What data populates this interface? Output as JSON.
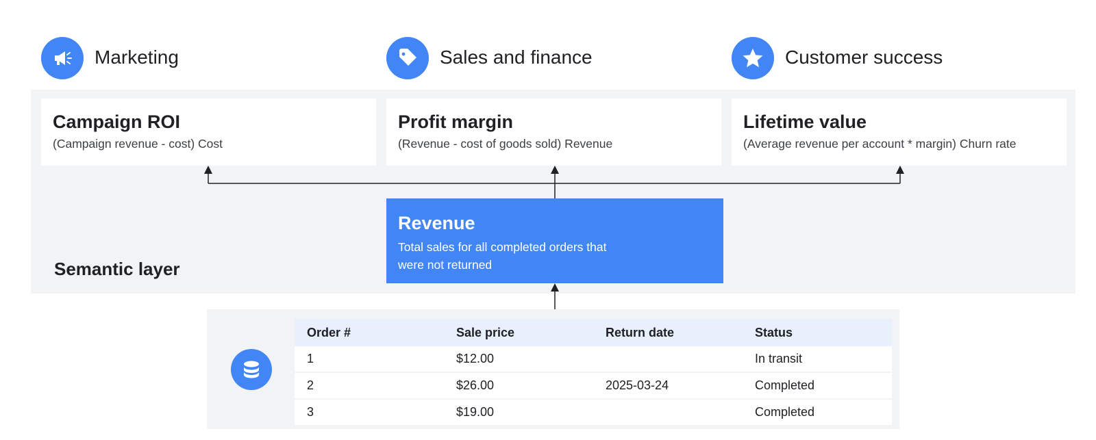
{
  "teams": [
    {
      "label": "Marketing",
      "icon": "megaphone-icon"
    },
    {
      "label": "Sales and finance",
      "icon": "tag-icon"
    },
    {
      "label": "Customer success",
      "icon": "star-icon"
    }
  ],
  "metrics": [
    {
      "title": "Campaign ROI",
      "formula": "(Campaign revenue - cost) Cost"
    },
    {
      "title": "Profit margin",
      "formula": "(Revenue - cost of goods sold) Revenue"
    },
    {
      "title": "Lifetime value",
      "formula": "(Average revenue per account * margin) Churn rate"
    }
  ],
  "revenue": {
    "title": "Revenue",
    "description": "Total sales for all completed orders that were not returned"
  },
  "semantic_layer_label": "Semantic layer",
  "data_source": {
    "icon": "database-icon",
    "columns": [
      "Order #",
      "Sale price",
      "Return date",
      "Status"
    ],
    "rows": [
      [
        "1",
        "$12.00",
        "",
        "In transit"
      ],
      [
        "2",
        "$26.00",
        "2025-03-24",
        "Completed"
      ],
      [
        "3",
        "$19.00",
        "",
        "Completed"
      ]
    ]
  },
  "colors": {
    "accent": "#4285f4",
    "panel": "#f1f3f4",
    "table_header": "#e8f0fe",
    "text": "#202124"
  }
}
